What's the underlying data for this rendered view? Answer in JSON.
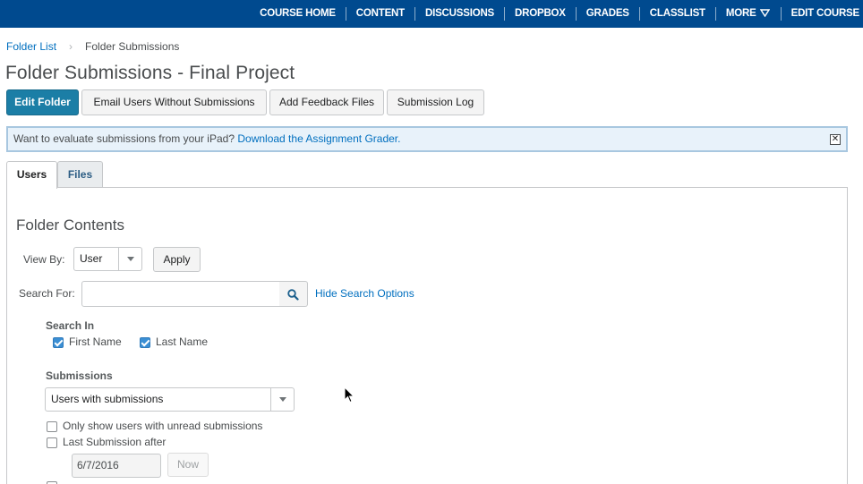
{
  "topnav": {
    "items": [
      "COURSE HOME",
      "CONTENT",
      "DISCUSSIONS",
      "DROPBOX",
      "GRADES",
      "CLASSLIST",
      "MORE",
      "EDIT COURSE"
    ],
    "background": "#004a8f"
  },
  "breadcrumb": {
    "parent": "Folder List",
    "current": "Folder Submissions"
  },
  "page_title": "Folder Submissions - Final Project",
  "toolbar": {
    "edit_folder": "Edit Folder",
    "email_users": "Email Users Without Submissions",
    "add_feedback": "Add Feedback Files",
    "submission_log": "Submission Log"
  },
  "alert": {
    "text": "Want to evaluate submissions from your iPad?",
    "link": "Download the Assignment Grader."
  },
  "tabs": [
    "Users",
    "Files"
  ],
  "section_title": "Folder Contents",
  "view_by": {
    "label": "View By:",
    "value": "User",
    "apply": "Apply"
  },
  "search": {
    "label": "Search For:",
    "value": "",
    "hide_options": "Hide Search Options"
  },
  "search_in": {
    "heading": "Search In",
    "first_name": "First Name",
    "last_name": "Last Name",
    "first_name_checked": true,
    "last_name_checked": true
  },
  "submissions": {
    "heading": "Submissions",
    "selected": "Users with submissions",
    "unread_only": "Only show users with unread submissions",
    "last_after": "Last Submission after",
    "date": "6/7/2016",
    "now": "Now"
  },
  "colors": {
    "primary_button": "#1b7ea6",
    "link": "#006fbf",
    "checkbox_checked": "#3b8fd4",
    "alert_bg": "#e8f2fa"
  }
}
